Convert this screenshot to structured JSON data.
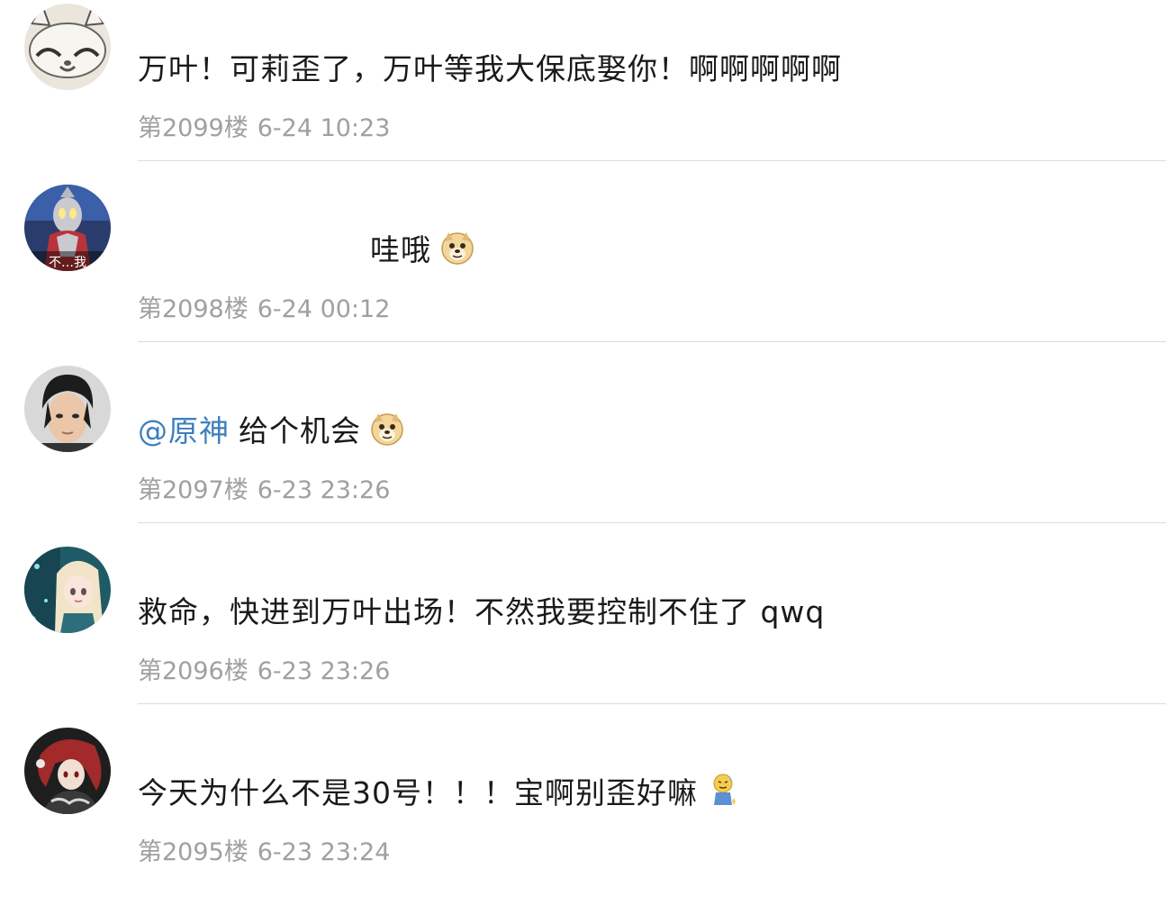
{
  "comments": [
    {
      "mention": "",
      "text": "万叶！可莉歪了，万叶等我大保底娶你！啊啊啊啊啊",
      "emoji": "",
      "floor": "第2099楼",
      "time": "6-24 10:23",
      "avatar_icon": "cat-avatar"
    },
    {
      "mention": "",
      "text": "哇哦",
      "emoji": "doge-emoji",
      "floor": "第2098楼",
      "time": "6-24 00:12",
      "avatar_icon": "ultraman-avatar",
      "avatar_caption": "不…我"
    },
    {
      "mention": "@原神",
      "text": "给个机会",
      "emoji": "doge-emoji",
      "floor": "第2097楼",
      "time": "6-23 23:26",
      "avatar_icon": "man-portrait-avatar"
    },
    {
      "mention": "",
      "text": "救命，快进到万叶出场！不然我要控制不住了 qwq",
      "emoji": "",
      "floor": "第2096楼",
      "time": "6-23 23:26",
      "avatar_icon": "anime-girl-avatar"
    },
    {
      "mention": "",
      "text": "今天为什么不是30号！！！宝啊别歪好嘛",
      "emoji": "sweat-smile-emoji",
      "floor": "第2095楼",
      "time": "6-23 23:24",
      "avatar_icon": "red-hair-anime-avatar"
    }
  ],
  "colors": {
    "text": "#1a1a1a",
    "meta": "#a0a0a0",
    "mention": "#3e7fbd",
    "divider": "#dcdcdc"
  }
}
